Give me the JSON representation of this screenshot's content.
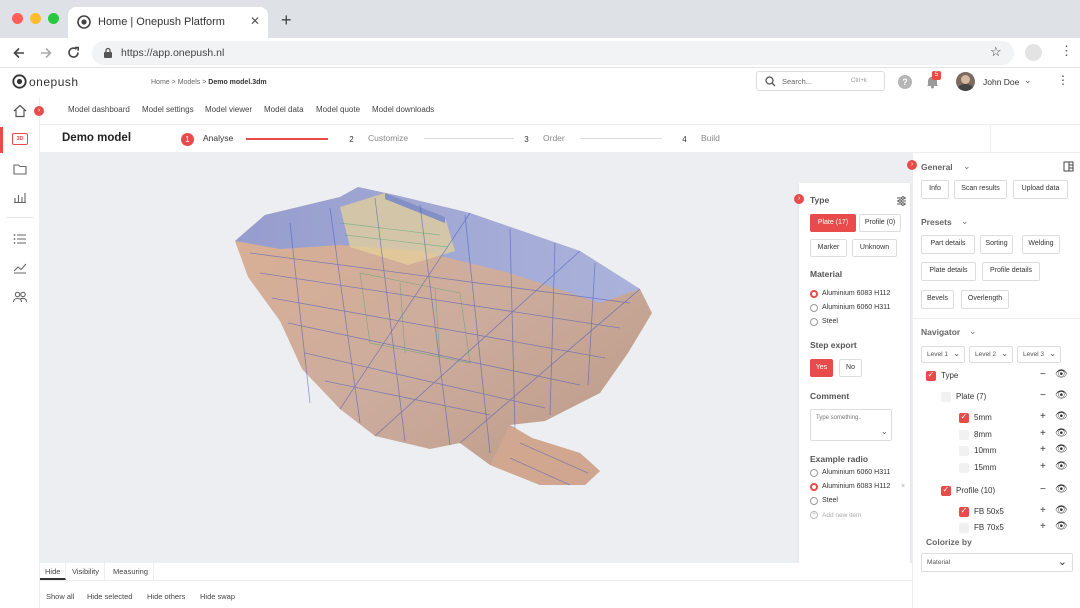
{
  "browser": {
    "tab_title": "Home | Onepush Platform",
    "url": "https://app.onepush.nl"
  },
  "app": {
    "logo_text": "onepush",
    "breadcrumb": [
      "Home",
      "Models",
      "Demo model.3dm"
    ],
    "search_placeholder": "Search...",
    "search_shortcut": "Ctrl+k",
    "notification_count": "5",
    "user_name": "John Doe",
    "accent": "#e94b4b"
  },
  "nav": [
    "Model dashboard",
    "Model settings",
    "Model viewer",
    "Model data",
    "Model quote",
    "Model downloads"
  ],
  "stepper": {
    "title": "Demo model",
    "steps": [
      {
        "num": "1",
        "label": "Analyse",
        "active": true
      },
      {
        "num": "2",
        "label": "Customize"
      },
      {
        "num": "3",
        "label": "Order"
      },
      {
        "num": "4",
        "label": "Build"
      }
    ]
  },
  "type_panel": {
    "title": "Type",
    "type_buttons": [
      "Plate (17)",
      "Profile (0)",
      "Marker",
      "Unknown"
    ],
    "material_title": "Material",
    "materials": [
      "Aluminium 6083 H112",
      "Aluminium 6060 H311",
      "Steel"
    ],
    "step_export_title": "Step export",
    "step_export_options": [
      "Yes",
      "No"
    ],
    "comment_title": "Comment",
    "comment_placeholder": "Type something..",
    "example_radio_title": "Example radio",
    "example_radio": [
      "Aluminium 6060 H311",
      "Aluminium 6083 H112",
      "Steel"
    ],
    "add_new": "Add new item"
  },
  "right_panel": {
    "general_title": "General",
    "general_buttons": [
      "Info",
      "Scan results",
      "Upload data"
    ],
    "presets_title": "Presets",
    "preset_buttons": [
      "Part details",
      "Sorting",
      "Welding",
      "Plate details",
      "Profile details",
      "Bevels",
      "Overlength"
    ],
    "navigator_title": "Navigator",
    "levels": [
      "Level 1",
      "Level 2",
      "Level 3"
    ],
    "tree": [
      {
        "label": "Type",
        "checked": true,
        "ctrl": "−",
        "indent": 0
      },
      {
        "label": "Plate (7)",
        "checked": false,
        "ctrl": "−",
        "indent": 1
      },
      {
        "label": "5mm",
        "checked": true,
        "ctrl": "+",
        "indent": 2
      },
      {
        "label": "8mm",
        "checked": false,
        "ctrl": "+",
        "indent": 2
      },
      {
        "label": "10mm",
        "checked": false,
        "ctrl": "+",
        "indent": 2
      },
      {
        "label": "15mm",
        "checked": false,
        "ctrl": "+",
        "indent": 2
      },
      {
        "label": "Profile (10)",
        "checked": true,
        "ctrl": "−",
        "indent": 1
      },
      {
        "label": "FB 50x5",
        "checked": true,
        "ctrl": "+",
        "indent": 2
      },
      {
        "label": "FB 70x5",
        "checked": false,
        "ctrl": "+",
        "indent": 2
      }
    ],
    "colorize_title": "Colorize by",
    "colorize_value": "Material"
  },
  "bottom": {
    "tabs": [
      "Hide",
      "Visibility",
      "Measuring"
    ],
    "actions": [
      "Show all",
      "Hide selected",
      "Hide others",
      "Hide swap"
    ]
  }
}
